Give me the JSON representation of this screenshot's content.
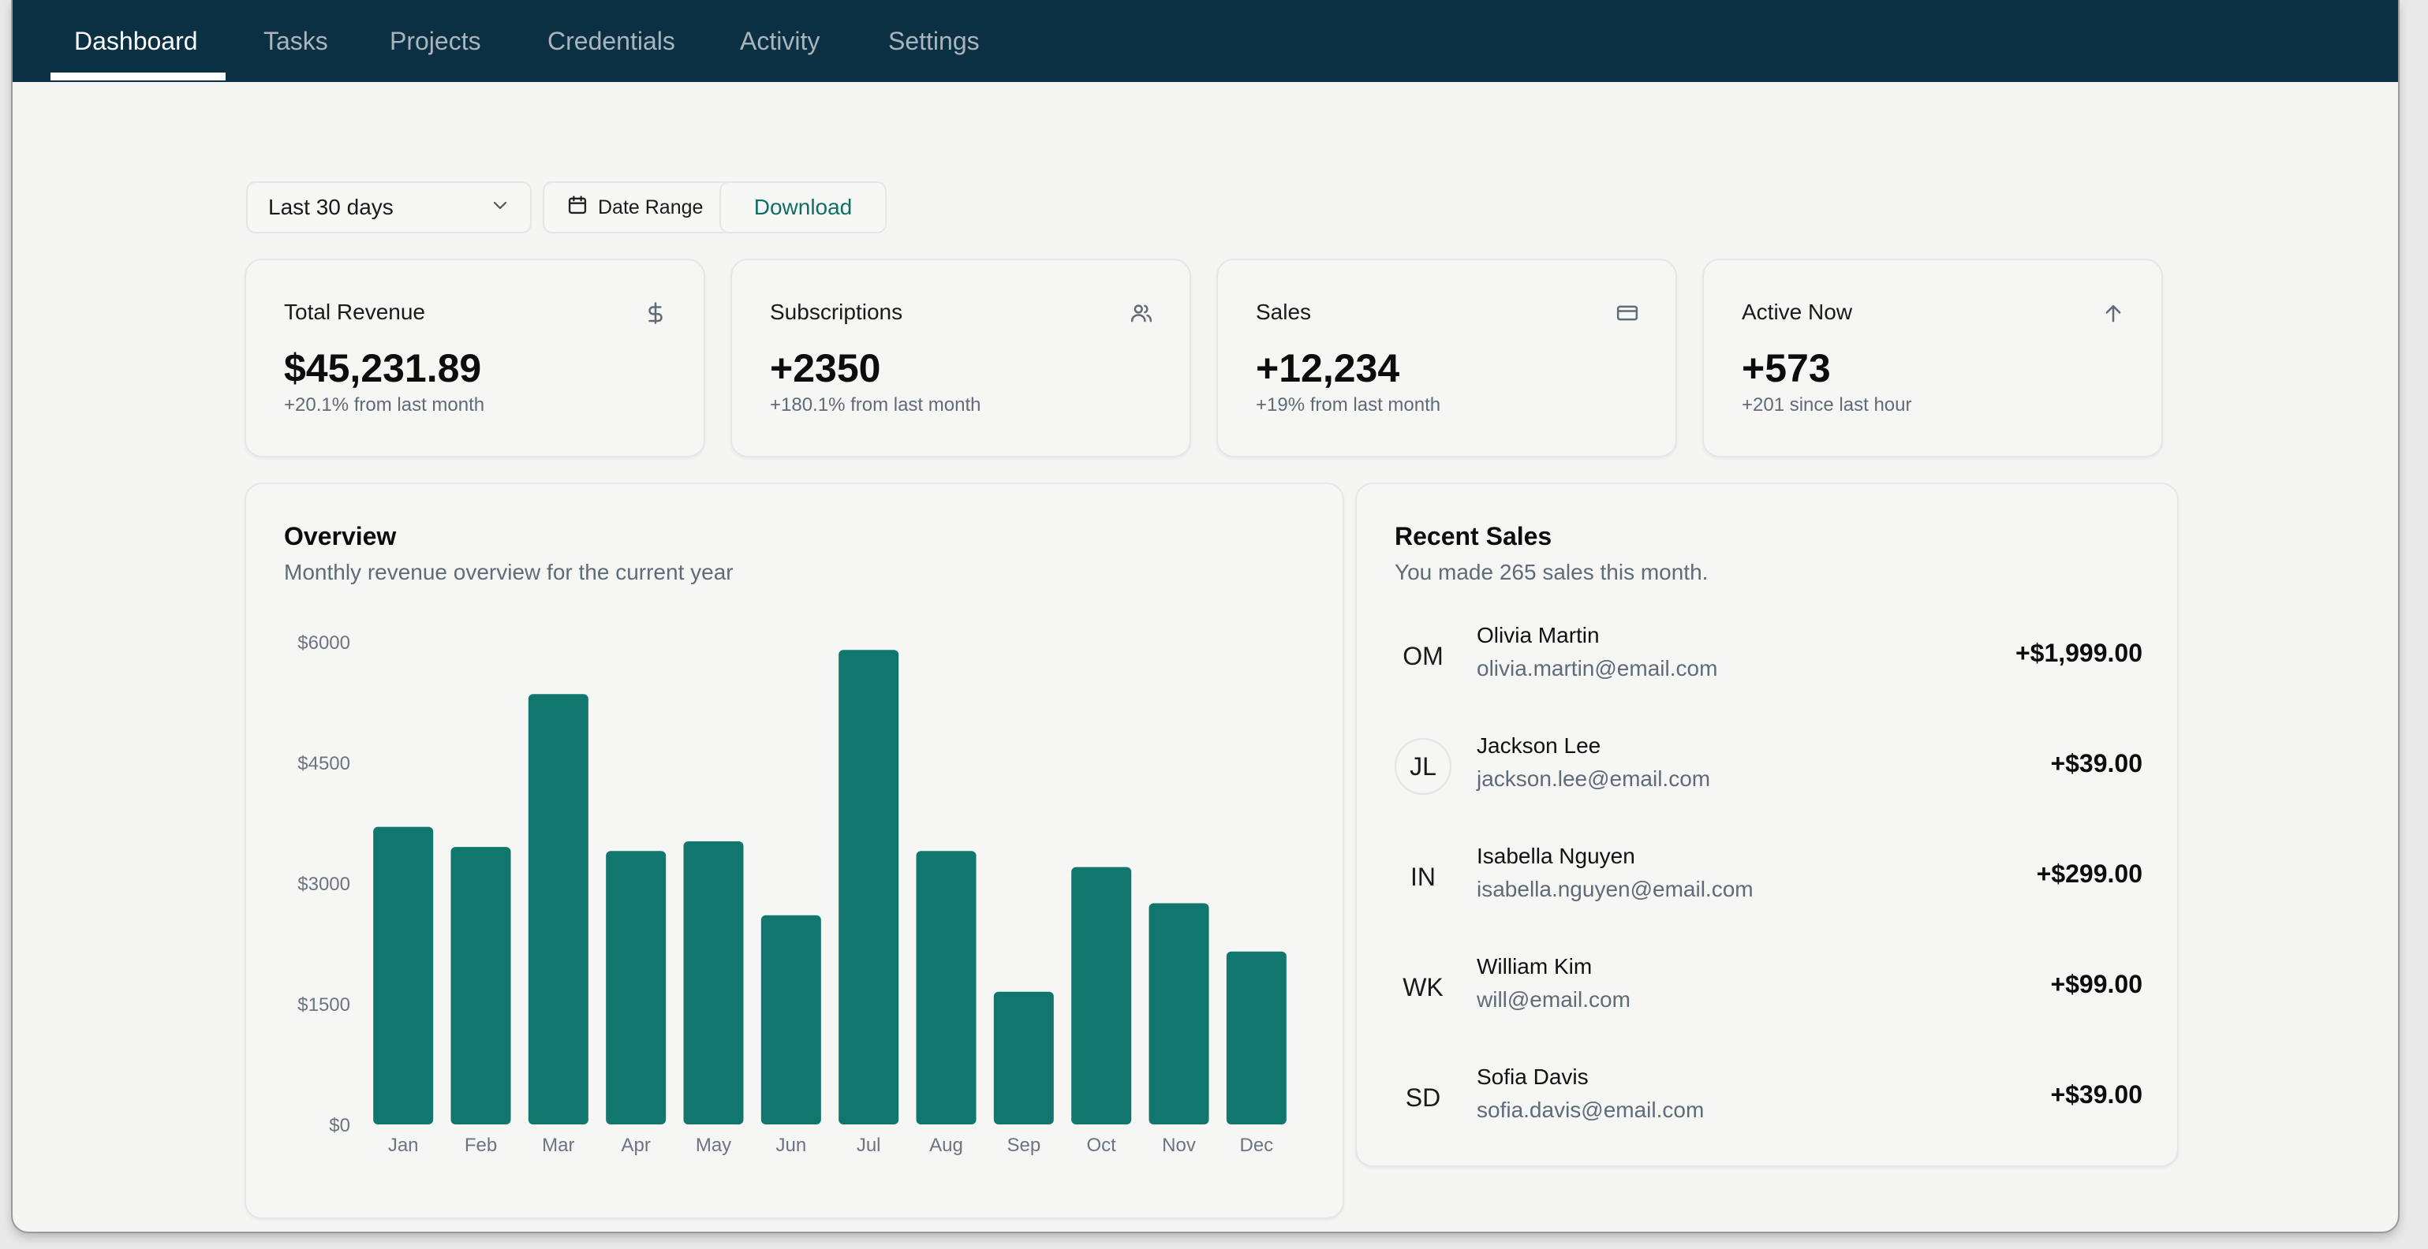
{
  "nav": {
    "tabs": [
      {
        "label": "Dashboard",
        "active": true
      },
      {
        "label": "Tasks"
      },
      {
        "label": "Projects"
      },
      {
        "label": "Credentials"
      },
      {
        "label": "Activity"
      },
      {
        "label": "Settings"
      }
    ]
  },
  "toolbar": {
    "range_select": "Last 30 days",
    "date_range_label": "Date Range",
    "download_label": "Download"
  },
  "stats": [
    {
      "title": "Total Revenue",
      "value": "$45,231.89",
      "note": "+20.1% from last month",
      "icon": "dollar-icon"
    },
    {
      "title": "Subscriptions",
      "value": "+2350",
      "note": "+180.1% from last month",
      "icon": "users-icon"
    },
    {
      "title": "Sales",
      "value": "+12,234",
      "note": "+19% from last month",
      "icon": "credit-card-icon"
    },
    {
      "title": "Active Now",
      "value": "+573",
      "note": "+201 since last hour",
      "icon": "arrow-up-icon"
    }
  ],
  "overview": {
    "title": "Overview",
    "subtitle": "Monthly revenue overview for the current year"
  },
  "chart_data": {
    "type": "bar",
    "categories": [
      "Jan",
      "Feb",
      "Mar",
      "Apr",
      "May",
      "Jun",
      "Jul",
      "Aug",
      "Sep",
      "Oct",
      "Nov",
      "Dec"
    ],
    "values": [
      3700,
      3450,
      5350,
      3400,
      3520,
      2600,
      5900,
      3400,
      1650,
      3200,
      2750,
      2150
    ],
    "yticks": [
      "$0",
      "$1500",
      "$3000",
      "$4500",
      "$6000"
    ],
    "ytick_values": [
      0,
      1500,
      3000,
      4500,
      6000
    ],
    "ylim": [
      0,
      6000
    ],
    "bar_color": "#11766d",
    "grid": false
  },
  "recent_sales": {
    "title": "Recent Sales",
    "subtitle": "You made 265 sales this month.",
    "items": [
      {
        "initials": "OM",
        "name": "Olivia Martin",
        "email": "olivia.martin@email.com",
        "amount": "+$1,999.00"
      },
      {
        "initials": "JL",
        "name": "Jackson Lee",
        "email": "jackson.lee@email.com",
        "amount": "+$39.00"
      },
      {
        "initials": "IN",
        "name": "Isabella Nguyen",
        "email": "isabella.nguyen@email.com",
        "amount": "+$299.00"
      },
      {
        "initials": "WK",
        "name": "William Kim",
        "email": "will@email.com",
        "amount": "+$99.00"
      },
      {
        "initials": "SD",
        "name": "Sofia Davis",
        "email": "sofia.davis@email.com",
        "amount": "+$39.00"
      }
    ]
  },
  "colors": {
    "nav_bg": "#0b3043",
    "accent": "#0f6f64",
    "page_bg": "#f5f5f4"
  }
}
